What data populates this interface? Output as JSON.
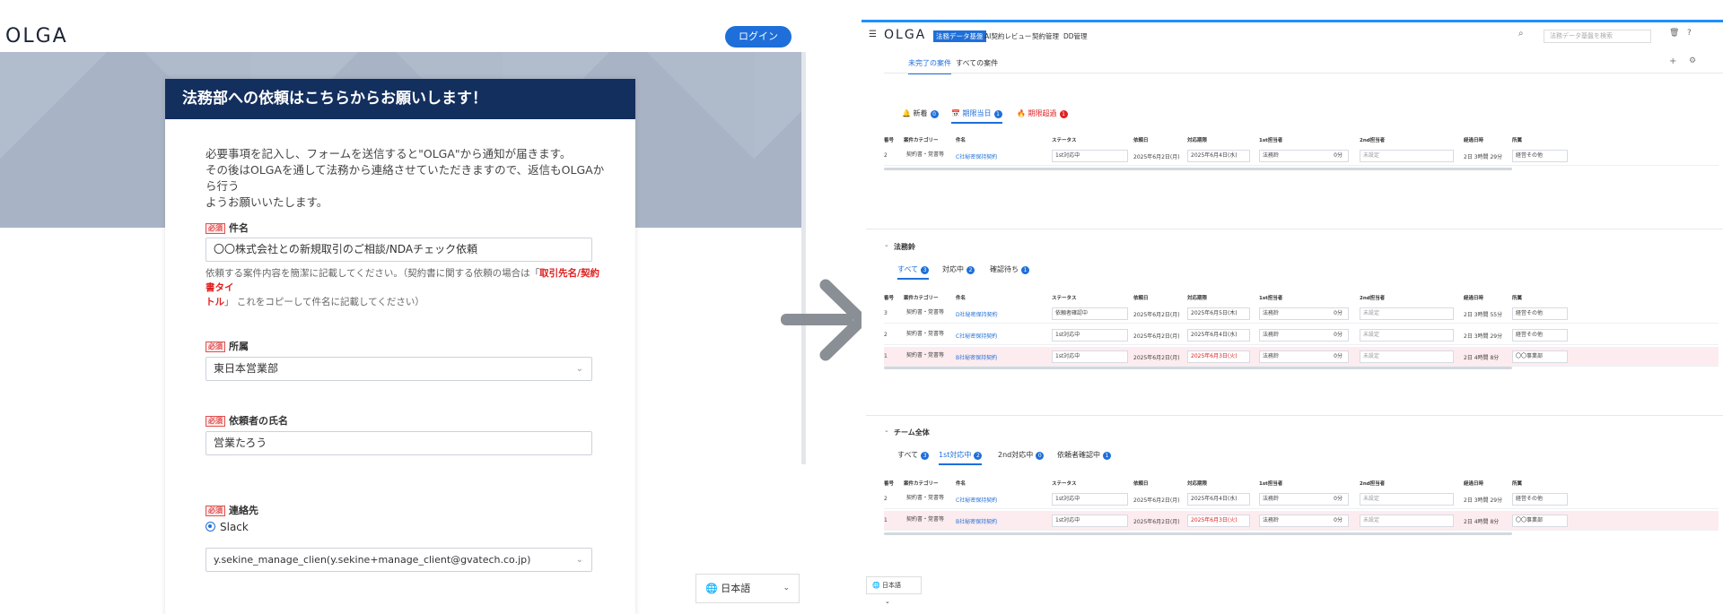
{
  "left": {
    "logo": "OLGA",
    "login_label": "ログイン",
    "form_title": "法務部への依頼はこちらからお願いします！",
    "intro_line1": "必要事項を記入し、フォームを送信すると\"OLGA\"から通知が届きます。",
    "intro_line2": "その後はOLGAを通して法務から連絡させていただきますので、返信もOLGAから行う",
    "intro_line3": "ようお願いいたします。",
    "required": "必須",
    "fields": {
      "subject_label": "件名",
      "subject_value": "〇〇株式会社との新規取引のご相談/NDAチェック依頼",
      "subject_help1": "依頼する案件内容を簡潔に記載してください。（契約書に関する依頼の場合は「",
      "subject_help_hl1": "取引先名/契約書タイ",
      "subject_help_hl2": "トル",
      "subject_help2": "」 これをコピーして件名に記載してください）",
      "dept_label": "所属",
      "dept_value": "東日本営業部",
      "name_label": "依頼者の氏名",
      "name_value": "営業たろう",
      "contact_label": "連絡先",
      "contact_radio": "Slack",
      "contact_value": "y.sekine_manage_clien(y.sekine+manage_client@gvatech.co.jp)"
    },
    "language": "日本語"
  },
  "right": {
    "logo": "OLGA",
    "nav": [
      "法務データ基盤",
      "AI契約レビュー",
      "契約管理",
      "DD管理"
    ],
    "search_placeholder": "法務データ基盤を検索",
    "subtabs": [
      "未完了の案件",
      "すべての案件"
    ],
    "top_filters": [
      {
        "label": "新着",
        "count": "0",
        "color": "blue"
      },
      {
        "label": "期限当日",
        "count": "1",
        "color": "blue"
      },
      {
        "label": "期限超過",
        "count": "1",
        "color": "red"
      }
    ],
    "columns": [
      "番号",
      "案件カテゴリー",
      "件名",
      "ステータス",
      "依頼日",
      "対応期限",
      "1st担当者",
      "2nd担当者",
      "経過日時",
      "所属"
    ],
    "top_rows": [
      {
        "num": "2",
        "cat": "契約書・覚書等",
        "title": "C社秘密保持契約",
        "status": "1st対応中",
        "req": "2025年6月2日(月)",
        "due": "2025年6月4日(水)",
        "first": "法務鈴",
        "time": "0分",
        "second": "未設定",
        "elapsed": "2日 3時間 29分",
        "dept": "経営その他",
        "pink": false
      }
    ],
    "legal": {
      "title": "法務鈴",
      "filters": [
        {
          "label": "すべて",
          "count": "3"
        },
        {
          "label": "対応中",
          "count": "2"
        },
        {
          "label": "確認待ち",
          "count": "1"
        }
      ],
      "rows": [
        {
          "num": "3",
          "cat": "契約書・覚書等",
          "title": "D社秘密保持契約",
          "status": "依頼者確認中",
          "req": "2025年6月2日(月)",
          "due": "2025年6月5日(木)",
          "first": "法務鈴",
          "time": "0分",
          "second": "未設定",
          "elapsed": "2日 3時間 55分",
          "dept": "経営その他",
          "pink": false
        },
        {
          "num": "2",
          "cat": "契約書・覚書等",
          "title": "C社秘密保持契約",
          "status": "1st対応中",
          "req": "2025年6月2日(月)",
          "due": "2025年6月4日(水)",
          "first": "法務鈴",
          "time": "0分",
          "second": "未設定",
          "elapsed": "2日 3時間 29分",
          "dept": "経営その他",
          "pink": false
        },
        {
          "num": "1",
          "cat": "契約書・覚書等",
          "title": "B社秘密保持契約",
          "status": "1st対応中",
          "req": "2025年6月2日(月)",
          "due": "2025年6月3日(火)",
          "first": "法務鈴",
          "time": "0分",
          "second": "未設定",
          "elapsed": "2日 4時間 8分",
          "dept": "〇〇事業部",
          "pink": true
        }
      ]
    },
    "team": {
      "title": "チーム全体",
      "filters": [
        {
          "label": "すべて",
          "count": "3"
        },
        {
          "label": "1st対応中",
          "count": "2"
        },
        {
          "label": "2nd対応中",
          "count": "0"
        },
        {
          "label": "依頼者確認中",
          "count": "1"
        }
      ],
      "rows": [
        {
          "num": "2",
          "cat": "契約書・覚書等",
          "title": "C社秘密保持契約",
          "status": "1st対応中",
          "req": "2025年6月2日(月)",
          "due": "2025年6月4日(水)",
          "first": "法務鈴",
          "time": "0分",
          "second": "未設定",
          "elapsed": "2日 3時間 29分",
          "dept": "経営その他",
          "pink": false
        },
        {
          "num": "1",
          "cat": "契約書・覚書等",
          "title": "B社秘密保持契約",
          "status": "1st対応中",
          "req": "2025年6月2日(月)",
          "due": "2025年6月3日(火)",
          "first": "法務鈴",
          "time": "0分",
          "second": "未設定",
          "elapsed": "2日 4時間 8分",
          "dept": "〇〇事業部",
          "pink": true
        }
      ]
    },
    "language": "日本語"
  }
}
